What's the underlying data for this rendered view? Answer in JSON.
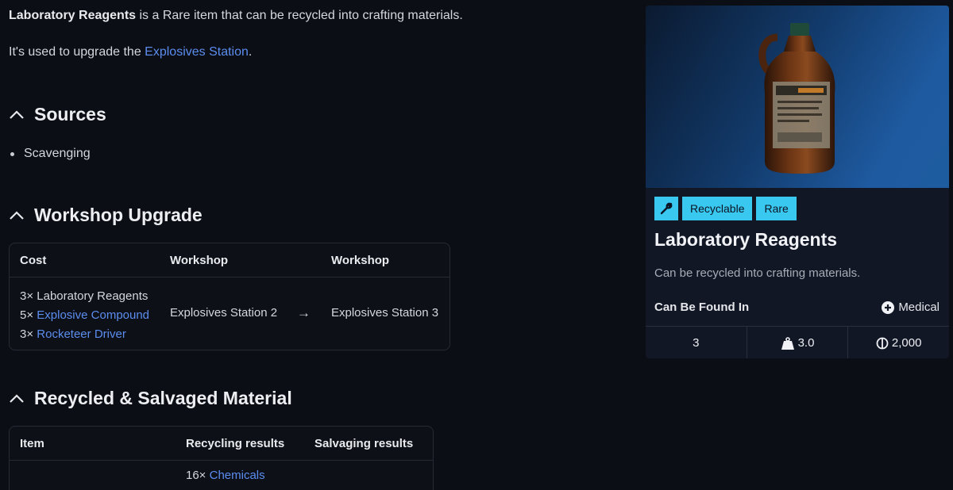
{
  "intro": {
    "item_name": "Laboratory Reagents",
    "line1_rest": " is a Rare item that can be recycled into crafting materials.",
    "line2_prefix": "It's used to upgrade the ",
    "line2_link": "Explosives Station",
    "line2_suffix": "."
  },
  "sources": {
    "heading": "Sources",
    "items": [
      "Scavenging"
    ]
  },
  "workshop_upgrade": {
    "heading": "Workshop Upgrade",
    "columns": [
      "Cost",
      "Workshop",
      "Workshop"
    ],
    "cost": [
      {
        "qty": "3×",
        "name": "Laboratory Reagents",
        "link": false
      },
      {
        "qty": "5×",
        "name": "Explosive Compound",
        "link": true
      },
      {
        "qty": "3×",
        "name": "Rocketeer Driver",
        "link": true
      }
    ],
    "from": "Explosives Station 2",
    "arrow": "→",
    "to": "Explosives Station 3"
  },
  "recycled": {
    "heading": "Recycled & Salvaged Material",
    "columns": [
      "Item",
      "Recycling results",
      "Salvaging results"
    ],
    "partial_row": {
      "qty": "16×",
      "name": "Chemicals"
    }
  },
  "card": {
    "badge_icon": "wrench-icon",
    "badges": [
      "Recyclable",
      "Rare"
    ],
    "title": "Laboratory Reagents",
    "description": "Can be recycled into crafting materials.",
    "found_label": "Can Be Found In",
    "found_icon": "plus-circle-icon",
    "found_value": "Medical",
    "stats": {
      "stack": "3",
      "weight_icon": "weight-icon",
      "weight": "3.0",
      "price_icon": "coin-icon",
      "price": "2,000"
    },
    "colors": {
      "badge": "#39c8f0",
      "link": "#5b8def"
    }
  }
}
